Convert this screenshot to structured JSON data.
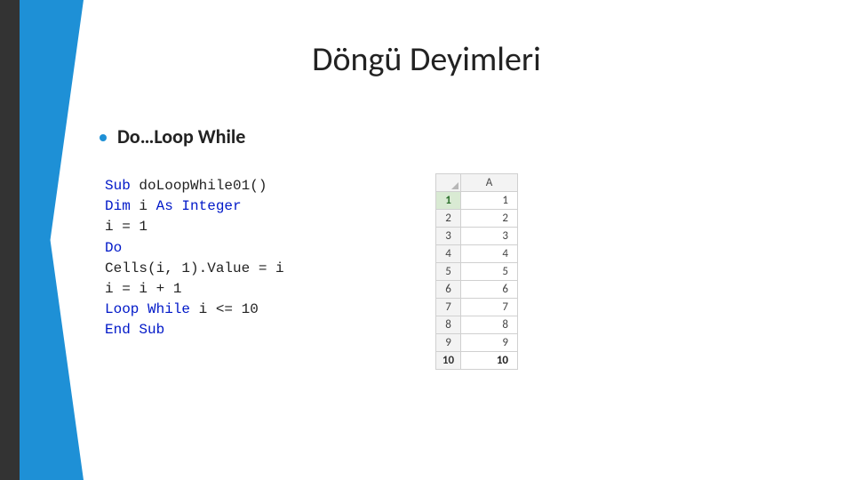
{
  "title": "Döngü Deyimleri",
  "bullet": "Do…Loop While",
  "code": {
    "0": {
      "a": "Sub ",
      "b": "doLoopWhile01()"
    },
    "1": {
      "a": "Dim ",
      "b": "i ",
      "c": "As ",
      "d": "",
      "e": "Integer"
    },
    "2": {
      "a": "i = 1"
    },
    "3": {
      "a": "Do"
    },
    "4": {
      "a": "Cells(i, 1).Value = i"
    },
    "5": {
      "a": "i = i + 1"
    },
    "6": {
      "a": "Loop While ",
      "b": "i <= 10"
    },
    "7": {
      "a": "End Sub"
    }
  },
  "sheet": {
    "col": "A",
    "rows": [
      {
        "n": "1",
        "v": "1"
      },
      {
        "n": "2",
        "v": "2"
      },
      {
        "n": "3",
        "v": "3"
      },
      {
        "n": "4",
        "v": "4"
      },
      {
        "n": "5",
        "v": "5"
      },
      {
        "n": "6",
        "v": "6"
      },
      {
        "n": "7",
        "v": "7"
      },
      {
        "n": "8",
        "v": "8"
      },
      {
        "n": "9",
        "v": "9"
      },
      {
        "n": "10",
        "v": "10"
      }
    ]
  }
}
